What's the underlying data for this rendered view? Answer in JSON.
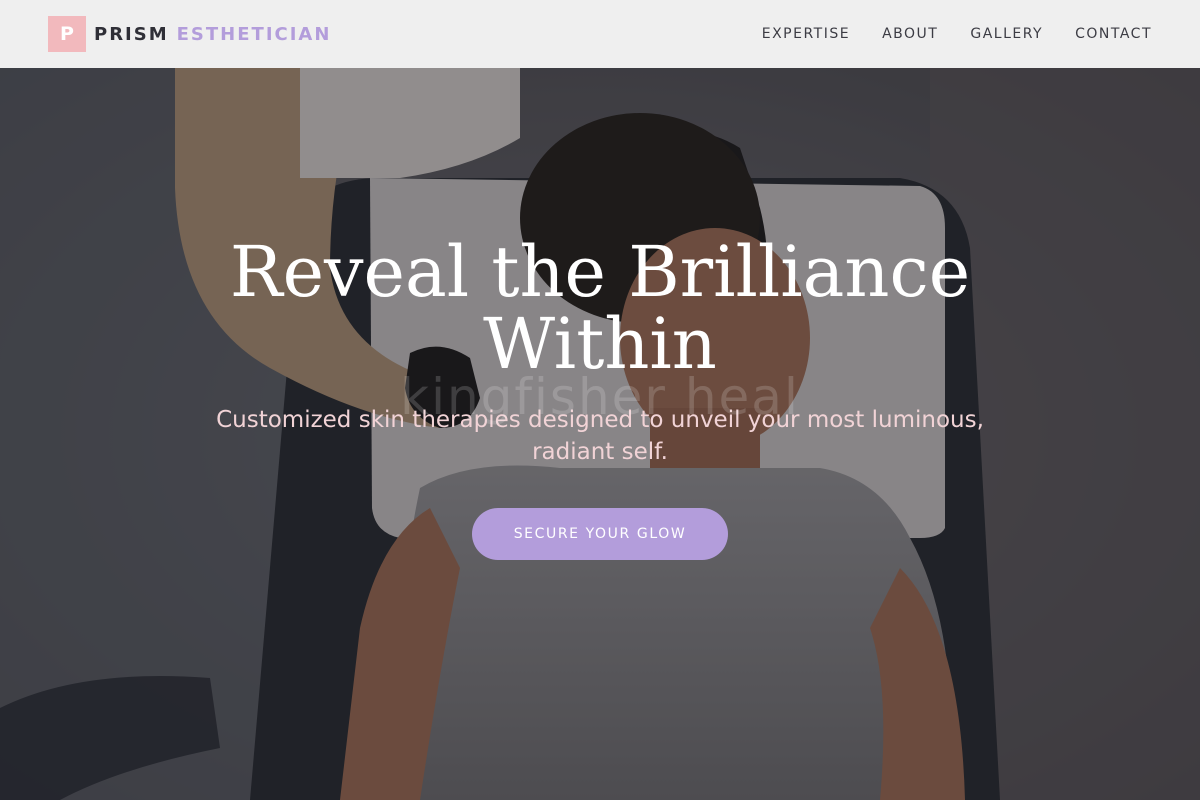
{
  "brand": {
    "mark": "P",
    "name_primary": "PRISM",
    "name_secondary": "ESTHETICIAN",
    "colors": {
      "mark_bg": "#f2b9bd",
      "accent": "#b39ddb",
      "dark_text": "#2f2f37"
    }
  },
  "nav": {
    "items": [
      {
        "label": "EXPERTISE"
      },
      {
        "label": "ABOUT"
      },
      {
        "label": "GALLERY"
      },
      {
        "label": "CONTACT"
      }
    ]
  },
  "hero": {
    "title": "Reveal the Brilliance Within",
    "subtitle": "Customized skin therapies designed to unveil your most luminous, radiant self.",
    "watermark": "kingfisher heal",
    "cta_label": "SECURE YOUR GLOW",
    "colors": {
      "subtitle": "#f1d3d6",
      "cta_bg": "#b39ddb"
    }
  }
}
